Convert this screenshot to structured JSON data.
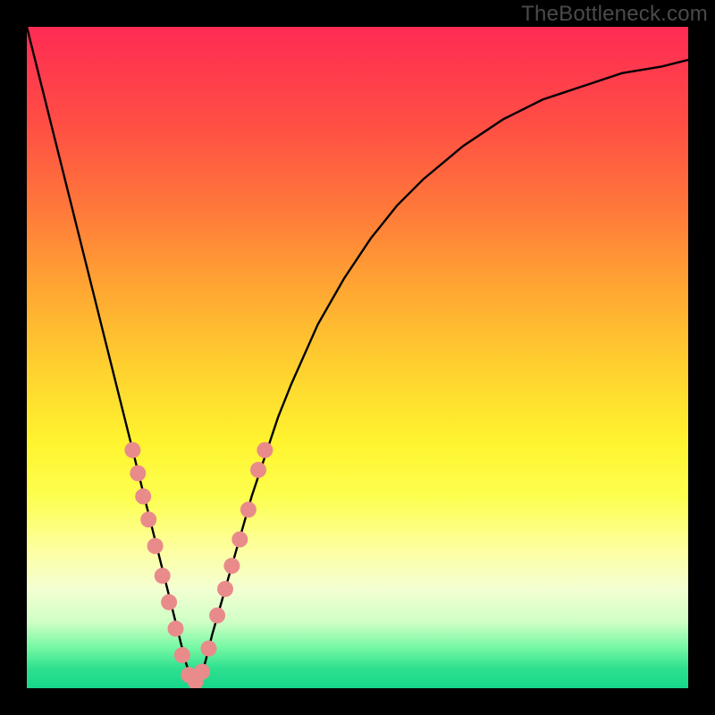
{
  "watermark": "TheBottleneck.com",
  "chart_data": {
    "type": "line",
    "title": "",
    "xlabel": "",
    "ylabel": "",
    "xlim": [
      0,
      100
    ],
    "ylim": [
      0,
      100
    ],
    "series": [
      {
        "name": "bottleneck-curve",
        "x": [
          0,
          2,
          4,
          6,
          8,
          10,
          12,
          14,
          16,
          18,
          20,
          21,
          22,
          23,
          24,
          25,
          26,
          27,
          28,
          30,
          32,
          34,
          36,
          38,
          40,
          44,
          48,
          52,
          56,
          60,
          66,
          72,
          78,
          84,
          90,
          96,
          100
        ],
        "values": [
          100,
          92,
          84,
          76,
          68,
          60,
          52,
          44,
          36,
          28,
          20,
          16,
          12,
          8,
          4,
          1,
          1,
          4,
          8,
          15,
          22,
          29,
          35,
          41,
          46,
          55,
          62,
          68,
          73,
          77,
          82,
          86,
          89,
          91,
          93,
          94,
          95
        ]
      }
    ],
    "markers": {
      "name": "data-points",
      "color": "#e98b8b",
      "points": [
        {
          "x": 16.0,
          "y": 36.0
        },
        {
          "x": 16.8,
          "y": 32.5
        },
        {
          "x": 17.6,
          "y": 29.0
        },
        {
          "x": 18.4,
          "y": 25.5
        },
        {
          "x": 19.4,
          "y": 21.5
        },
        {
          "x": 20.5,
          "y": 17.0
        },
        {
          "x": 21.5,
          "y": 13.0
        },
        {
          "x": 22.5,
          "y": 9.0
        },
        {
          "x": 23.5,
          "y": 5.0
        },
        {
          "x": 24.5,
          "y": 2.0
        },
        {
          "x": 25.5,
          "y": 1.0
        },
        {
          "x": 26.5,
          "y": 2.5
        },
        {
          "x": 27.5,
          "y": 6.0
        },
        {
          "x": 28.8,
          "y": 11.0
        },
        {
          "x": 30.0,
          "y": 15.0
        },
        {
          "x": 31.0,
          "y": 18.5
        },
        {
          "x": 32.2,
          "y": 22.5
        },
        {
          "x": 33.5,
          "y": 27.0
        },
        {
          "x": 35.0,
          "y": 33.0
        },
        {
          "x": 36.0,
          "y": 36.0
        }
      ]
    }
  }
}
